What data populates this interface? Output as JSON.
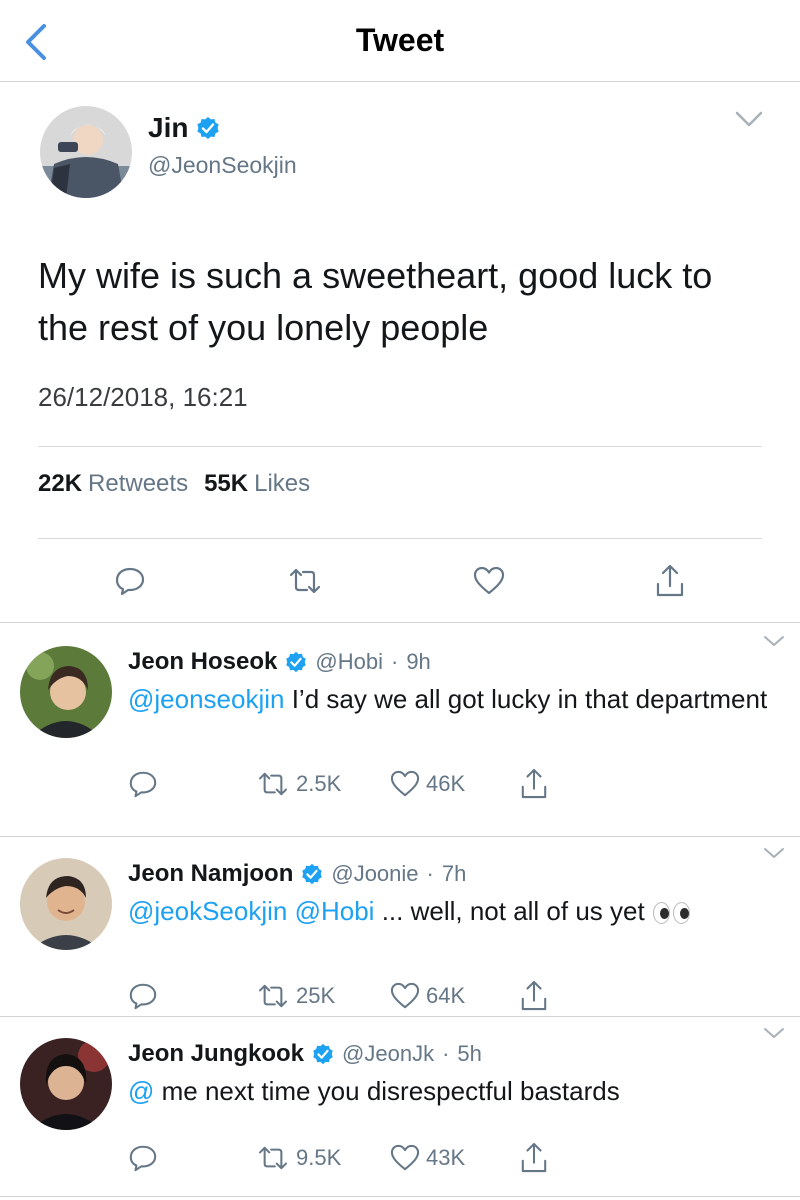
{
  "header": {
    "title": "Tweet"
  },
  "tweet": {
    "name": "Jin",
    "handle": "@JeonSeokjin",
    "text": "My wife is such a sweetheart, good luck to the rest of you lonely people",
    "timestamp": "26/12/2018, 16:21",
    "retweets_count": "22K",
    "retweets_label": "Retweets",
    "likes_count": "55K",
    "likes_label": "Likes"
  },
  "replies": [
    {
      "name": "Jeon Hoseok",
      "handle": "@Hobi",
      "time": "9h",
      "mention": "@jeonseokjin",
      "text": " I’d say we all got lucky in that department",
      "retweets": "2.5K",
      "likes": "46K"
    },
    {
      "name": "Jeon Namjoon",
      "handle": "@Joonie",
      "time": "7h",
      "mention": "@jeokSeokjin @Hobi",
      "text": " ... well, not all of us yet",
      "emoji": "eyes",
      "retweets": "25K",
      "likes": "64K"
    },
    {
      "name": "Jeon Jungkook",
      "handle": "@JeonJk",
      "time": "5h",
      "mention": "@",
      "text": " me next time you disrespectful bastards",
      "retweets": "9.5K",
      "likes": "43K"
    }
  ],
  "colors": {
    "accent": "#1da1f2",
    "verified": "#1da1f2",
    "secondary": "#657786"
  },
  "icons": [
    "back-chevron-icon",
    "verified-icon",
    "caret-down-icon",
    "reply-icon",
    "retweet-icon",
    "like-icon",
    "share-icon"
  ]
}
